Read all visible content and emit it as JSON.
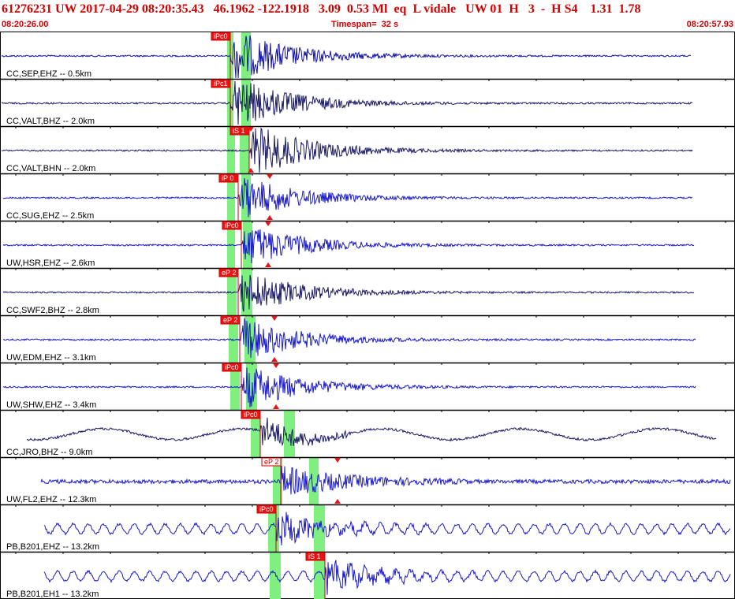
{
  "header": {
    "title": "61276231 UW 2017-04-29 08:20:35.43   46.1962 -122.1918   3.09  0.53 Ml  eq  L vidale   UW 01  H   3  -  H S4    1.31  1.78",
    "start_time": "08:20:26.00",
    "timespan": "Timespan=  32 s",
    "end_time": "08:20:57.93"
  },
  "colors": {
    "title": "#d40000",
    "frame": "#000000",
    "trace_blue": "#1a1acc",
    "trace_dark": "#1a1a66",
    "pick_fill": "#ee1111",
    "pick_line": "#cc0000",
    "window_green": "#7ff07f"
  },
  "traces": [
    {
      "label": "CC,SEP,EHZ -- 0.5km",
      "color": "dark-blue",
      "pick": "iPc0",
      "pick_style": "filled",
      "kind": "spike"
    },
    {
      "label": "CC,VALT,BHZ -- 2.0km",
      "color": "navy",
      "pick": "iPc1",
      "pick_style": "filled",
      "kind": "spike"
    },
    {
      "label": "CC,VALT,BHN -- 2.0km",
      "color": "navy",
      "pick": "iS 1",
      "pick_style": "filled",
      "kind": "spike"
    },
    {
      "label": "CC,SUG,EHZ -- 2.5km",
      "color": "blue",
      "pick": "iP 0",
      "pick_style": "filled",
      "kind": "normal"
    },
    {
      "label": "UW,HSR,EHZ -- 2.6km",
      "color": "blue",
      "pick": "iPc0",
      "pick_style": "filled",
      "kind": "normal"
    },
    {
      "label": "CC,SWF2,BHZ -- 2.8km",
      "color": "navy",
      "pick": "eP 2",
      "pick_style": "filled",
      "kind": "normal"
    },
    {
      "label": "UW,EDM,EHZ -- 3.1km",
      "color": "blue",
      "pick": "eP 2",
      "pick_style": "filled",
      "kind": "normal"
    },
    {
      "label": "UW,SHW,EHZ -- 3.4km",
      "color": "blue",
      "pick": "iPc0",
      "pick_style": "filled",
      "kind": "normal"
    },
    {
      "label": "CC,JRO,BHZ -- 9.0km",
      "color": "navy",
      "pick": "iPc0",
      "pick_style": "filled",
      "kind": "swell"
    },
    {
      "label": "UW,FL2,EHZ -- 12.3km",
      "color": "blue",
      "pick": "eP 2",
      "pick_style": "outline",
      "kind": "noisy"
    },
    {
      "label": "PB,B201,EHZ -- 13.2km",
      "color": "blue",
      "pick": "iPc0",
      "pick_style": "filled",
      "kind": "osc"
    },
    {
      "label": "PB,B201,EH1 -- 13.2km",
      "color": "blue",
      "pick": "iS 1",
      "pick_style": "filled",
      "kind": "osc"
    }
  ]
}
